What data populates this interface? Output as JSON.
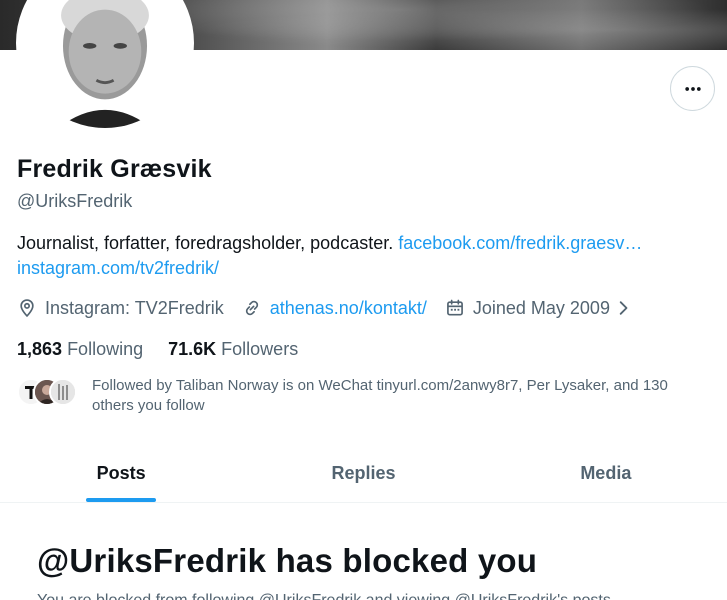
{
  "profile": {
    "name": "Fredrik Græsvik",
    "handle": "@UriksFredrik",
    "bio_text": "Journalist, forfatter, foredragsholder, podcaster. ",
    "bio_link1": "facebook.com/fredrik.graesv…",
    "bio_link2": "instagram.com/tv2fredrik/",
    "location": "Instagram: TV2Fredrik",
    "website": "athenas.no/kontakt/",
    "joined": "Joined May 2009"
  },
  "stats": {
    "following_count": "1,863",
    "following_label": "Following",
    "followers_count": "71.6K",
    "followers_label": "Followers"
  },
  "followed_by": "Followed by Taliban Norway is on WeChat tinyurl.com/2anwy8r7, Per Lysaker, and 130 others you follow",
  "tabs": [
    {
      "label": "Posts",
      "active": true
    },
    {
      "label": "Replies",
      "active": false
    },
    {
      "label": "Media",
      "active": false
    }
  ],
  "blocked": {
    "title": "@UriksFredrik has blocked you",
    "subtitle": "You are blocked from following @UriksFredrik and viewing @UriksFredrik's posts."
  },
  "icons": {
    "more": "more-horizontal-icon",
    "location": "location-pin-icon",
    "website": "link-icon",
    "joined": "calendar-icon",
    "chevron": "chevron-right-icon"
  },
  "colors": {
    "accent": "#1d9bf0",
    "secondary_text": "#536471",
    "primary_text": "#0f1419"
  }
}
